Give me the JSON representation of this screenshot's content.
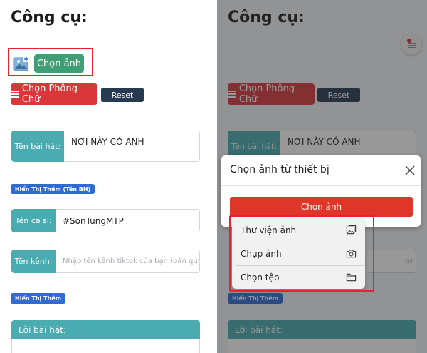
{
  "left": {
    "title": "Công cụ:",
    "choose_image_button": "Chọn ảnh",
    "choose_font_button": "Chọn Phông Chữ",
    "reset_button": "Reset",
    "song_name_label": "Tên bài hát:",
    "song_name_value": "NƠI NÀY CÓ ANH",
    "show_more_song_badge": "Hiển Thị Thêm (Tên BH)",
    "singer_label": "Tên ca sĩ:",
    "singer_value": "#SonTungMTP",
    "channel_label": "Tên kênh:",
    "channel_placeholder": "Nhập tên kênh tiktok của bạn (bản quyền)",
    "show_more_badge": "Hiển Thị Thêm",
    "lyrics_label": "Lời bài hát:"
  },
  "right": {
    "title": "Công cụ:",
    "choose_font_button": "Chọn Phông Chữ",
    "reset_button": "Reset",
    "song_name_label": "Tên bài hát:",
    "song_name_value": "NƠI NÀY CÓ ANH",
    "channel_placeholder": "n)",
    "show_more_badge": "Hiển Thị Thêm",
    "lyrics_label": "Lời bài hát:",
    "modal": {
      "title": "Chọn ảnh từ thiết bị",
      "choose_button": "Chọn ảnh"
    },
    "popup": {
      "items": [
        {
          "label": "Thư viện ảnh",
          "icon": "photo-library-icon"
        },
        {
          "label": "Chụp ảnh",
          "icon": "camera-icon"
        },
        {
          "label": "Chọn tệp",
          "icon": "folder-icon"
        }
      ]
    }
  },
  "colors": {
    "accent_red": "#d9373a",
    "teal": "#4aabb1",
    "green": "#3f9e73",
    "navy": "#263b52",
    "blue_badge": "#2f6bd3",
    "highlight": "#e0262a"
  }
}
